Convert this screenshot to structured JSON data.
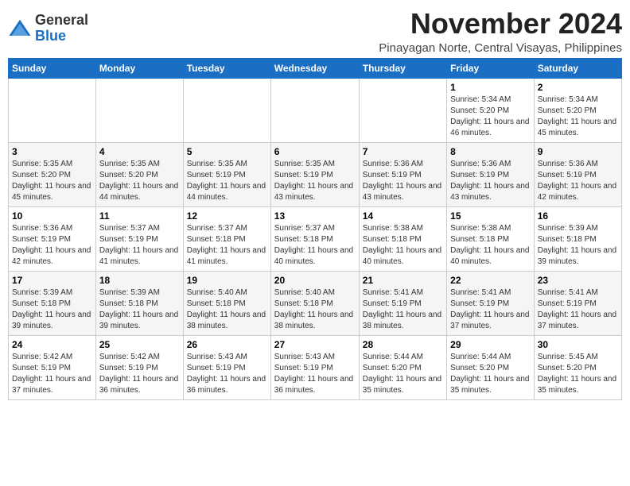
{
  "logo": {
    "general": "General",
    "blue": "Blue"
  },
  "title": "November 2024",
  "location": "Pinayagan Norte, Central Visayas, Philippines",
  "days_of_week": [
    "Sunday",
    "Monday",
    "Tuesday",
    "Wednesday",
    "Thursday",
    "Friday",
    "Saturday"
  ],
  "weeks": [
    [
      {
        "day": "",
        "info": ""
      },
      {
        "day": "",
        "info": ""
      },
      {
        "day": "",
        "info": ""
      },
      {
        "day": "",
        "info": ""
      },
      {
        "day": "",
        "info": ""
      },
      {
        "day": "1",
        "info": "Sunrise: 5:34 AM\nSunset: 5:20 PM\nDaylight: 11 hours and 46 minutes."
      },
      {
        "day": "2",
        "info": "Sunrise: 5:34 AM\nSunset: 5:20 PM\nDaylight: 11 hours and 45 minutes."
      }
    ],
    [
      {
        "day": "3",
        "info": "Sunrise: 5:35 AM\nSunset: 5:20 PM\nDaylight: 11 hours and 45 minutes."
      },
      {
        "day": "4",
        "info": "Sunrise: 5:35 AM\nSunset: 5:20 PM\nDaylight: 11 hours and 44 minutes."
      },
      {
        "day": "5",
        "info": "Sunrise: 5:35 AM\nSunset: 5:19 PM\nDaylight: 11 hours and 44 minutes."
      },
      {
        "day": "6",
        "info": "Sunrise: 5:35 AM\nSunset: 5:19 PM\nDaylight: 11 hours and 43 minutes."
      },
      {
        "day": "7",
        "info": "Sunrise: 5:36 AM\nSunset: 5:19 PM\nDaylight: 11 hours and 43 minutes."
      },
      {
        "day": "8",
        "info": "Sunrise: 5:36 AM\nSunset: 5:19 PM\nDaylight: 11 hours and 43 minutes."
      },
      {
        "day": "9",
        "info": "Sunrise: 5:36 AM\nSunset: 5:19 PM\nDaylight: 11 hours and 42 minutes."
      }
    ],
    [
      {
        "day": "10",
        "info": "Sunrise: 5:36 AM\nSunset: 5:19 PM\nDaylight: 11 hours and 42 minutes."
      },
      {
        "day": "11",
        "info": "Sunrise: 5:37 AM\nSunset: 5:19 PM\nDaylight: 11 hours and 41 minutes."
      },
      {
        "day": "12",
        "info": "Sunrise: 5:37 AM\nSunset: 5:18 PM\nDaylight: 11 hours and 41 minutes."
      },
      {
        "day": "13",
        "info": "Sunrise: 5:37 AM\nSunset: 5:18 PM\nDaylight: 11 hours and 40 minutes."
      },
      {
        "day": "14",
        "info": "Sunrise: 5:38 AM\nSunset: 5:18 PM\nDaylight: 11 hours and 40 minutes."
      },
      {
        "day": "15",
        "info": "Sunrise: 5:38 AM\nSunset: 5:18 PM\nDaylight: 11 hours and 40 minutes."
      },
      {
        "day": "16",
        "info": "Sunrise: 5:39 AM\nSunset: 5:18 PM\nDaylight: 11 hours and 39 minutes."
      }
    ],
    [
      {
        "day": "17",
        "info": "Sunrise: 5:39 AM\nSunset: 5:18 PM\nDaylight: 11 hours and 39 minutes."
      },
      {
        "day": "18",
        "info": "Sunrise: 5:39 AM\nSunset: 5:18 PM\nDaylight: 11 hours and 39 minutes."
      },
      {
        "day": "19",
        "info": "Sunrise: 5:40 AM\nSunset: 5:18 PM\nDaylight: 11 hours and 38 minutes."
      },
      {
        "day": "20",
        "info": "Sunrise: 5:40 AM\nSunset: 5:18 PM\nDaylight: 11 hours and 38 minutes."
      },
      {
        "day": "21",
        "info": "Sunrise: 5:41 AM\nSunset: 5:19 PM\nDaylight: 11 hours and 38 minutes."
      },
      {
        "day": "22",
        "info": "Sunrise: 5:41 AM\nSunset: 5:19 PM\nDaylight: 11 hours and 37 minutes."
      },
      {
        "day": "23",
        "info": "Sunrise: 5:41 AM\nSunset: 5:19 PM\nDaylight: 11 hours and 37 minutes."
      }
    ],
    [
      {
        "day": "24",
        "info": "Sunrise: 5:42 AM\nSunset: 5:19 PM\nDaylight: 11 hours and 37 minutes."
      },
      {
        "day": "25",
        "info": "Sunrise: 5:42 AM\nSunset: 5:19 PM\nDaylight: 11 hours and 36 minutes."
      },
      {
        "day": "26",
        "info": "Sunrise: 5:43 AM\nSunset: 5:19 PM\nDaylight: 11 hours and 36 minutes."
      },
      {
        "day": "27",
        "info": "Sunrise: 5:43 AM\nSunset: 5:19 PM\nDaylight: 11 hours and 36 minutes."
      },
      {
        "day": "28",
        "info": "Sunrise: 5:44 AM\nSunset: 5:20 PM\nDaylight: 11 hours and 35 minutes."
      },
      {
        "day": "29",
        "info": "Sunrise: 5:44 AM\nSunset: 5:20 PM\nDaylight: 11 hours and 35 minutes."
      },
      {
        "day": "30",
        "info": "Sunrise: 5:45 AM\nSunset: 5:20 PM\nDaylight: 11 hours and 35 minutes."
      }
    ]
  ]
}
